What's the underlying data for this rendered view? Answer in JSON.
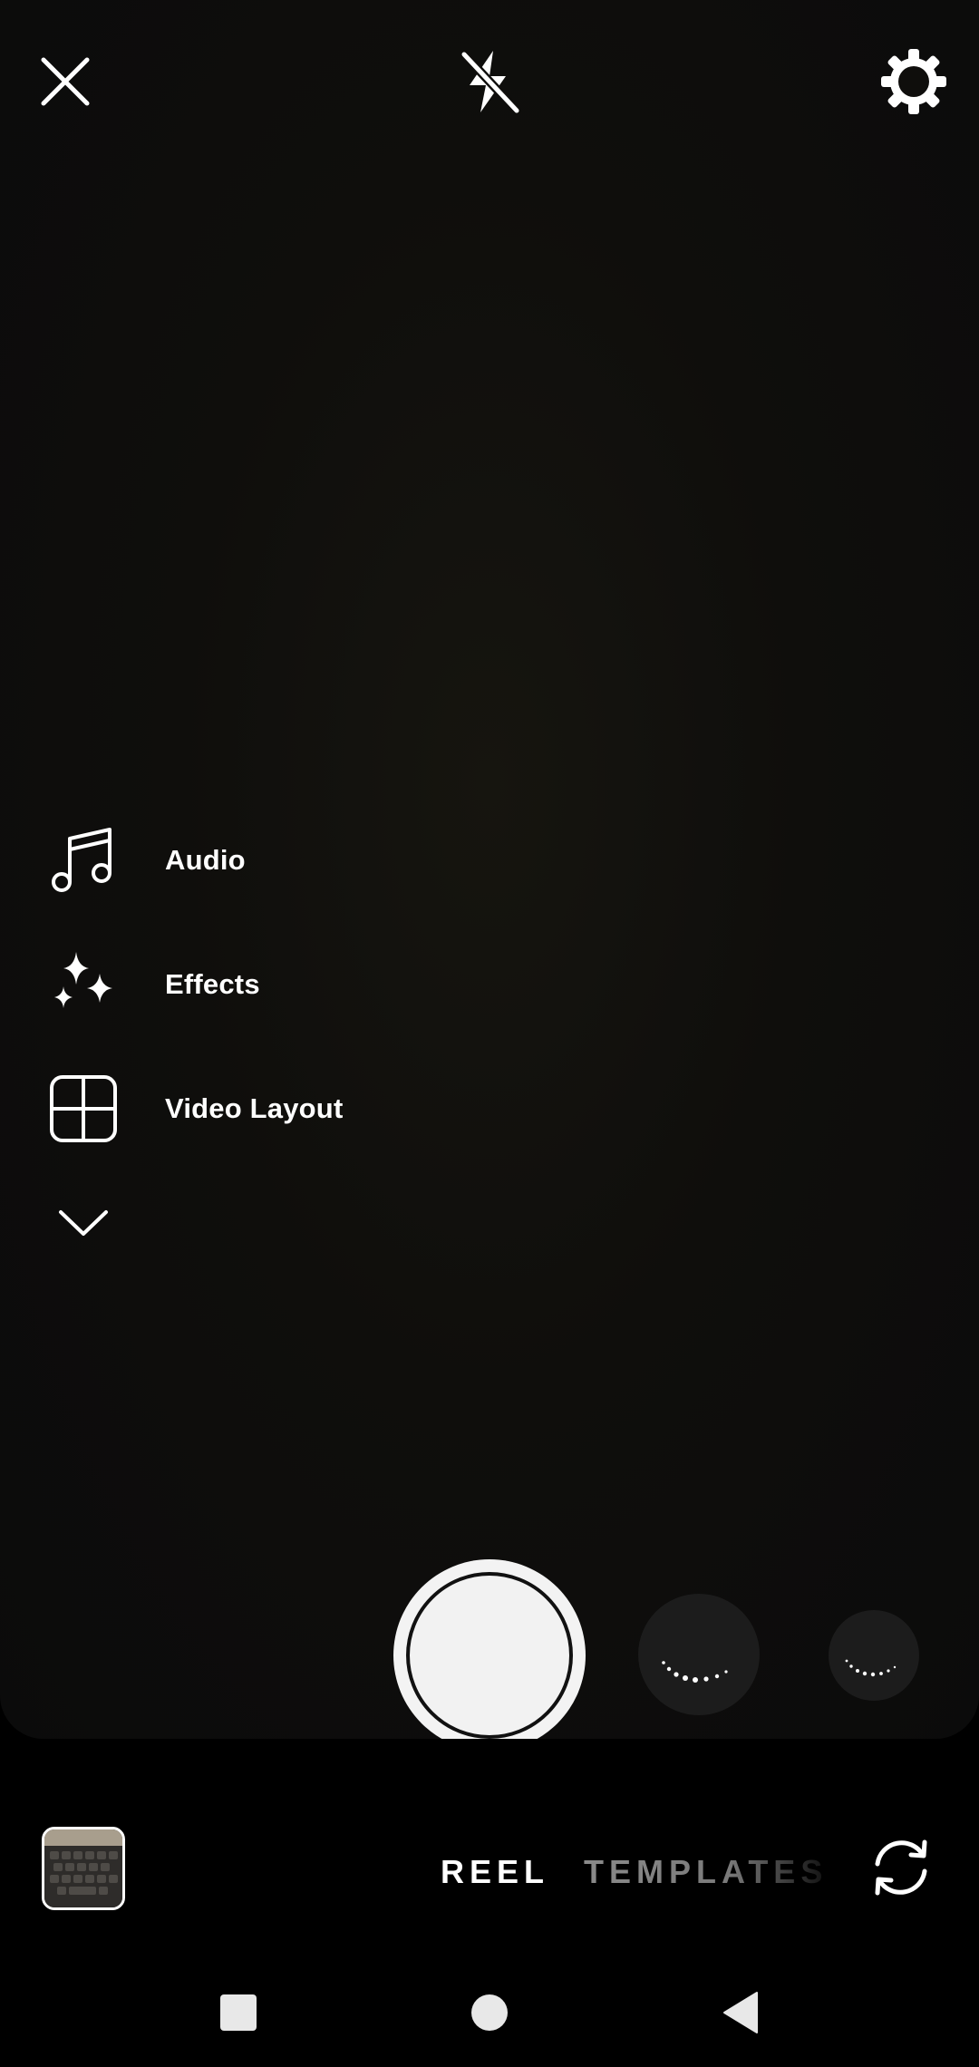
{
  "top_bar": {
    "close_icon": "close-icon",
    "flash_icon": "flash-off-icon",
    "settings_icon": "gear-icon"
  },
  "tools": [
    {
      "label": "Audio",
      "icon": "music-note-icon"
    },
    {
      "label": "Effects",
      "icon": "sparkles-icon"
    },
    {
      "label": "Video Layout",
      "icon": "layout-grid-icon"
    }
  ],
  "tools_collapse_icon": "chevron-down-icon",
  "capture": {
    "shutter_icon": "shutter-button",
    "effect_thumbnails": [
      "loading-spinner-icon",
      "loading-spinner-icon"
    ]
  },
  "bottom": {
    "modes": [
      "REEL",
      "TEMPLATES"
    ],
    "selected_mode": "REEL",
    "flip_icon": "flip-camera-icon"
  },
  "nav": [
    "recents-icon",
    "home-icon",
    "back-icon"
  ],
  "colors": {
    "background": "#000000",
    "viewfinder": "#0f0e0c",
    "text_primary": "#ffffff",
    "text_inactive": "#8a8a8a",
    "shutter": "#f3f3f3"
  }
}
